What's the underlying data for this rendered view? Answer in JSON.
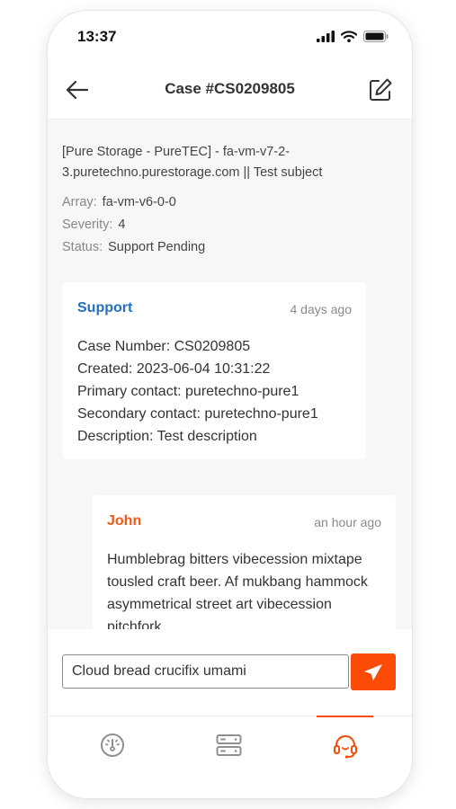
{
  "status_bar": {
    "time": "13:37"
  },
  "header": {
    "title": "Case #CS0209805"
  },
  "case": {
    "subject": "[Pure Storage - PureTEC] - fa-vm-v7-2-3.puretechno.purestorage.com || Test subject",
    "fields": [
      {
        "key": "Array:",
        "value": "fa-vm-v6-0-0"
      },
      {
        "key": "Severity:",
        "value": "4"
      },
      {
        "key": "Status:",
        "value": "Support Pending"
      }
    ]
  },
  "messages": [
    {
      "author": "Support",
      "author_color": "#1f6fc5",
      "time": "4 days ago",
      "lines": [
        "Case Number: CS0209805",
        "Created: 2023-06-04 10:31:22",
        "Primary contact: puretechno-pure1",
        "Secondary contact: puretechno-pure1",
        "Description: Test description"
      ]
    },
    {
      "author": "John",
      "author_color": "#f05a14",
      "time": "an hour ago",
      "text": "Humblebrag bitters vibecession mixtape tousled craft beer. Af mukbang hammock asymmetrical street art vibecession pitchfork."
    }
  ],
  "composer": {
    "value": "Cloud bread crucifix umami"
  },
  "tabs": [
    {
      "icon": "dashboard-gauge-icon",
      "active": false
    },
    {
      "icon": "servers-icon",
      "active": false
    },
    {
      "icon": "support-headset-icon",
      "active": true
    }
  ],
  "colors": {
    "accent": "#fa4c06",
    "support_blue": "#1f6fc5",
    "john_orange": "#f05a14"
  }
}
